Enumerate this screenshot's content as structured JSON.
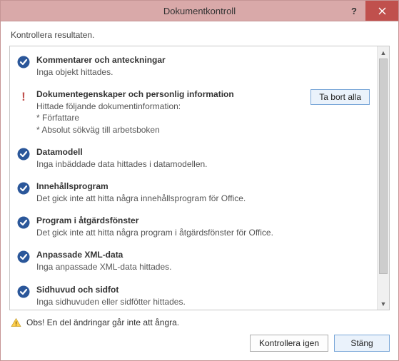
{
  "title": "Dokumentkontroll",
  "instruction": "Kontrollera resultaten.",
  "items": [
    {
      "status": "ok",
      "title": "Kommentarer och anteckningar",
      "lines": [
        "Inga objekt hittades."
      ],
      "action": null
    },
    {
      "status": "warn",
      "title": "Dokumentegenskaper och personlig information",
      "lines": [
        "Hittade följande dokumentinformation:",
        "* Författare",
        "* Absolut sökväg till arbetsboken"
      ],
      "action": "Ta bort alla"
    },
    {
      "status": "ok",
      "title": "Datamodell",
      "lines": [
        "Inga inbäddade data hittades i datamodellen."
      ],
      "action": null
    },
    {
      "status": "ok",
      "title": "Innehållsprogram",
      "lines": [
        "Det gick inte att hitta några innehållsprogram för Office."
      ],
      "action": null
    },
    {
      "status": "ok",
      "title": "Program i åtgärdsfönster",
      "lines": [
        "Det gick inte att hitta några program i åtgärdsfönster för Office."
      ],
      "action": null
    },
    {
      "status": "ok",
      "title": "Anpassade XML-data",
      "lines": [
        "Inga anpassade XML-data hittades."
      ],
      "action": null
    },
    {
      "status": "ok",
      "title": "Sidhuvud och sidfot",
      "lines": [
        "Inga sidhuvuden eller sidfötter hittades."
      ],
      "action": null
    }
  ],
  "footer_warning": "Obs! En del ändringar går inte att ångra.",
  "buttons": {
    "reinspect": "Kontrollera igen",
    "close": "Stäng"
  }
}
